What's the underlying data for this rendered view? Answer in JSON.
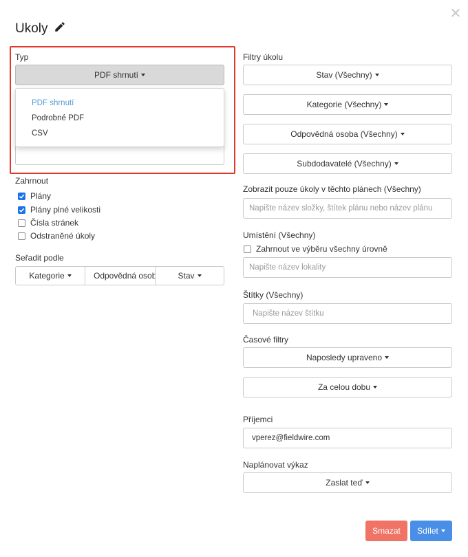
{
  "title": "Ukoly",
  "left": {
    "typ_label": "Typ",
    "typ_selected": "PDF shrnutí",
    "typ_options": [
      "PDF shrnutí",
      "Podrobné PDF",
      "CSV"
    ],
    "zahrnout_label": "Zahrnout",
    "include": [
      {
        "label": "Plány",
        "checked": true
      },
      {
        "label": "Plány plné velikosti",
        "checked": true
      },
      {
        "label": "Čísla stránek",
        "checked": false
      },
      {
        "label": "Odstraněné úkoly",
        "checked": false
      }
    ],
    "sort_label": "Seřadit podle",
    "sort_buttons": [
      "Kategorie",
      "Odpovědná osoba",
      "Stav"
    ]
  },
  "right": {
    "filtry_label": "Filtry úkolu",
    "filter_buttons": [
      "Stav (Všechny)",
      "Kategorie (Všechny)",
      "Odpovědná osoba (Všechny)",
      "Subdodavatelé (Všechny)"
    ],
    "plans_label": "Zobrazit pouze úkoly v těchto plánech (Všechny)",
    "plans_placeholder": "Napište název složky, štítek plánu nebo název plánu",
    "location_label": "Umístění (Všechny)",
    "location_checkbox": "Zahrnout ve výběru všechny úrovně",
    "location_checked": false,
    "location_placeholder": "Napište název lokality",
    "tags_label": "Štítky (Všechny)",
    "tags_placeholder": "Napište název štítku",
    "time_label": "Časové filtry",
    "time_buttons": [
      "Naposledy upraveno",
      "Za celou dobu"
    ],
    "recipients_label": "Příjemci",
    "recipients_value": "vperez@fieldwire.com",
    "schedule_label": "Naplánovat výkaz",
    "schedule_button": "Zaslat teď"
  },
  "footer": {
    "delete_label": "Smazat",
    "share_label": "Sdílet"
  },
  "colors": {
    "highlight": "#e03a2f",
    "danger": "#f07466",
    "primary": "#4a8fe7",
    "active_option": "#5b9bd5",
    "checkbox": "#1a73e8"
  },
  "icons": {
    "close": "close-icon",
    "edit": "pencil-icon"
  }
}
